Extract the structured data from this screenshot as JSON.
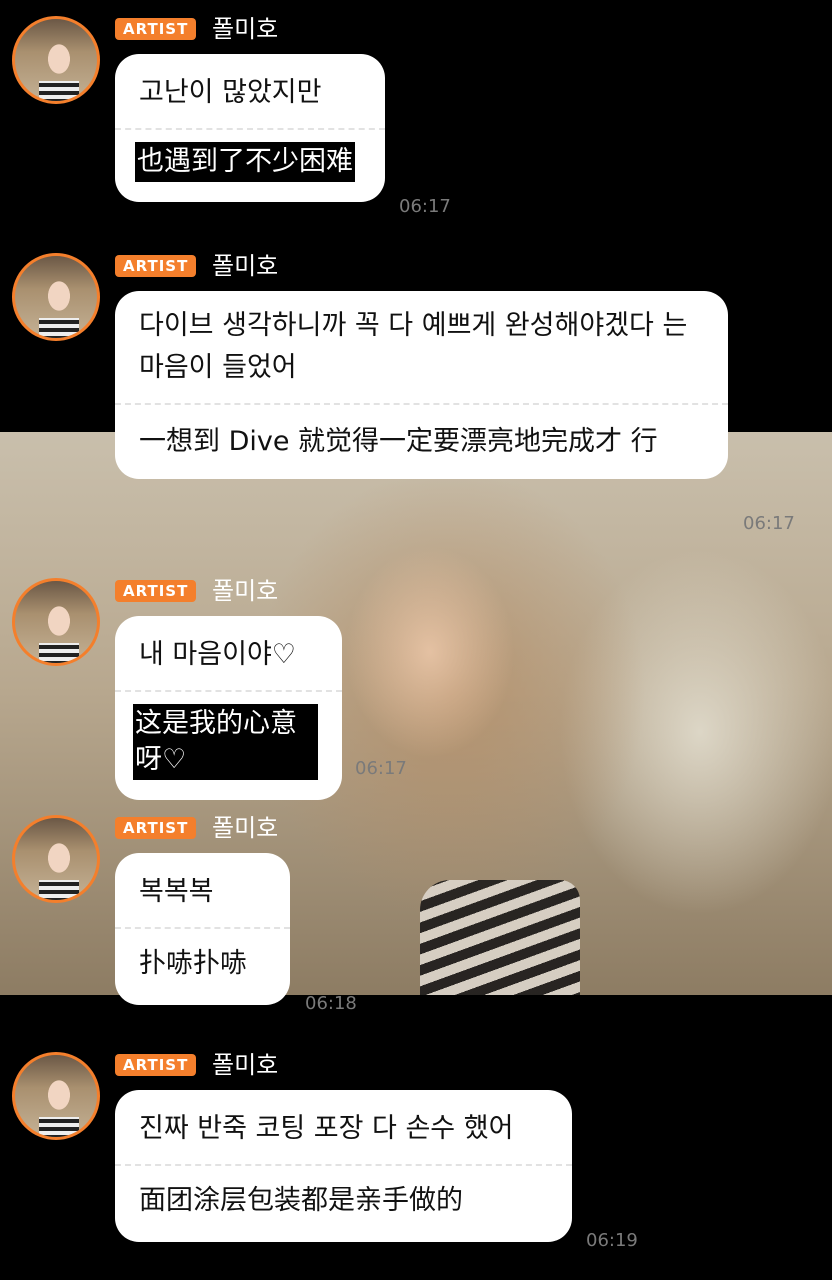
{
  "messages": [
    {
      "badge": "ARTIST",
      "name": "폴미호",
      "korean": "고난이 많았지만",
      "chinese": "也遇到了不少困难",
      "time": "06:17"
    },
    {
      "badge": "ARTIST",
      "name": "폴미호",
      "korean": "다이브 생각하니까 꼭 다 예쁘게 완성해야겠다 는 마음이 들었어",
      "chinese": "一想到 Dive 就觉得一定要漂亮地完成才 行",
      "time": "06:17"
    },
    {
      "badge": "ARTIST",
      "name": "폴미호",
      "korean": "내 마음이야♡",
      "chinese": "这是我的心意呀♡",
      "time": "06:17"
    },
    {
      "badge": "ARTIST",
      "name": "폴미호",
      "korean": "복복복",
      "chinese": "扑哧扑哧",
      "time": "06:18"
    },
    {
      "badge": "ARTIST",
      "name": "폴미호",
      "korean": "진짜 반죽 코팅 포장 다 손수 했어",
      "chinese": "面团涂层包装都是亲手做的",
      "time": "06:19"
    }
  ]
}
